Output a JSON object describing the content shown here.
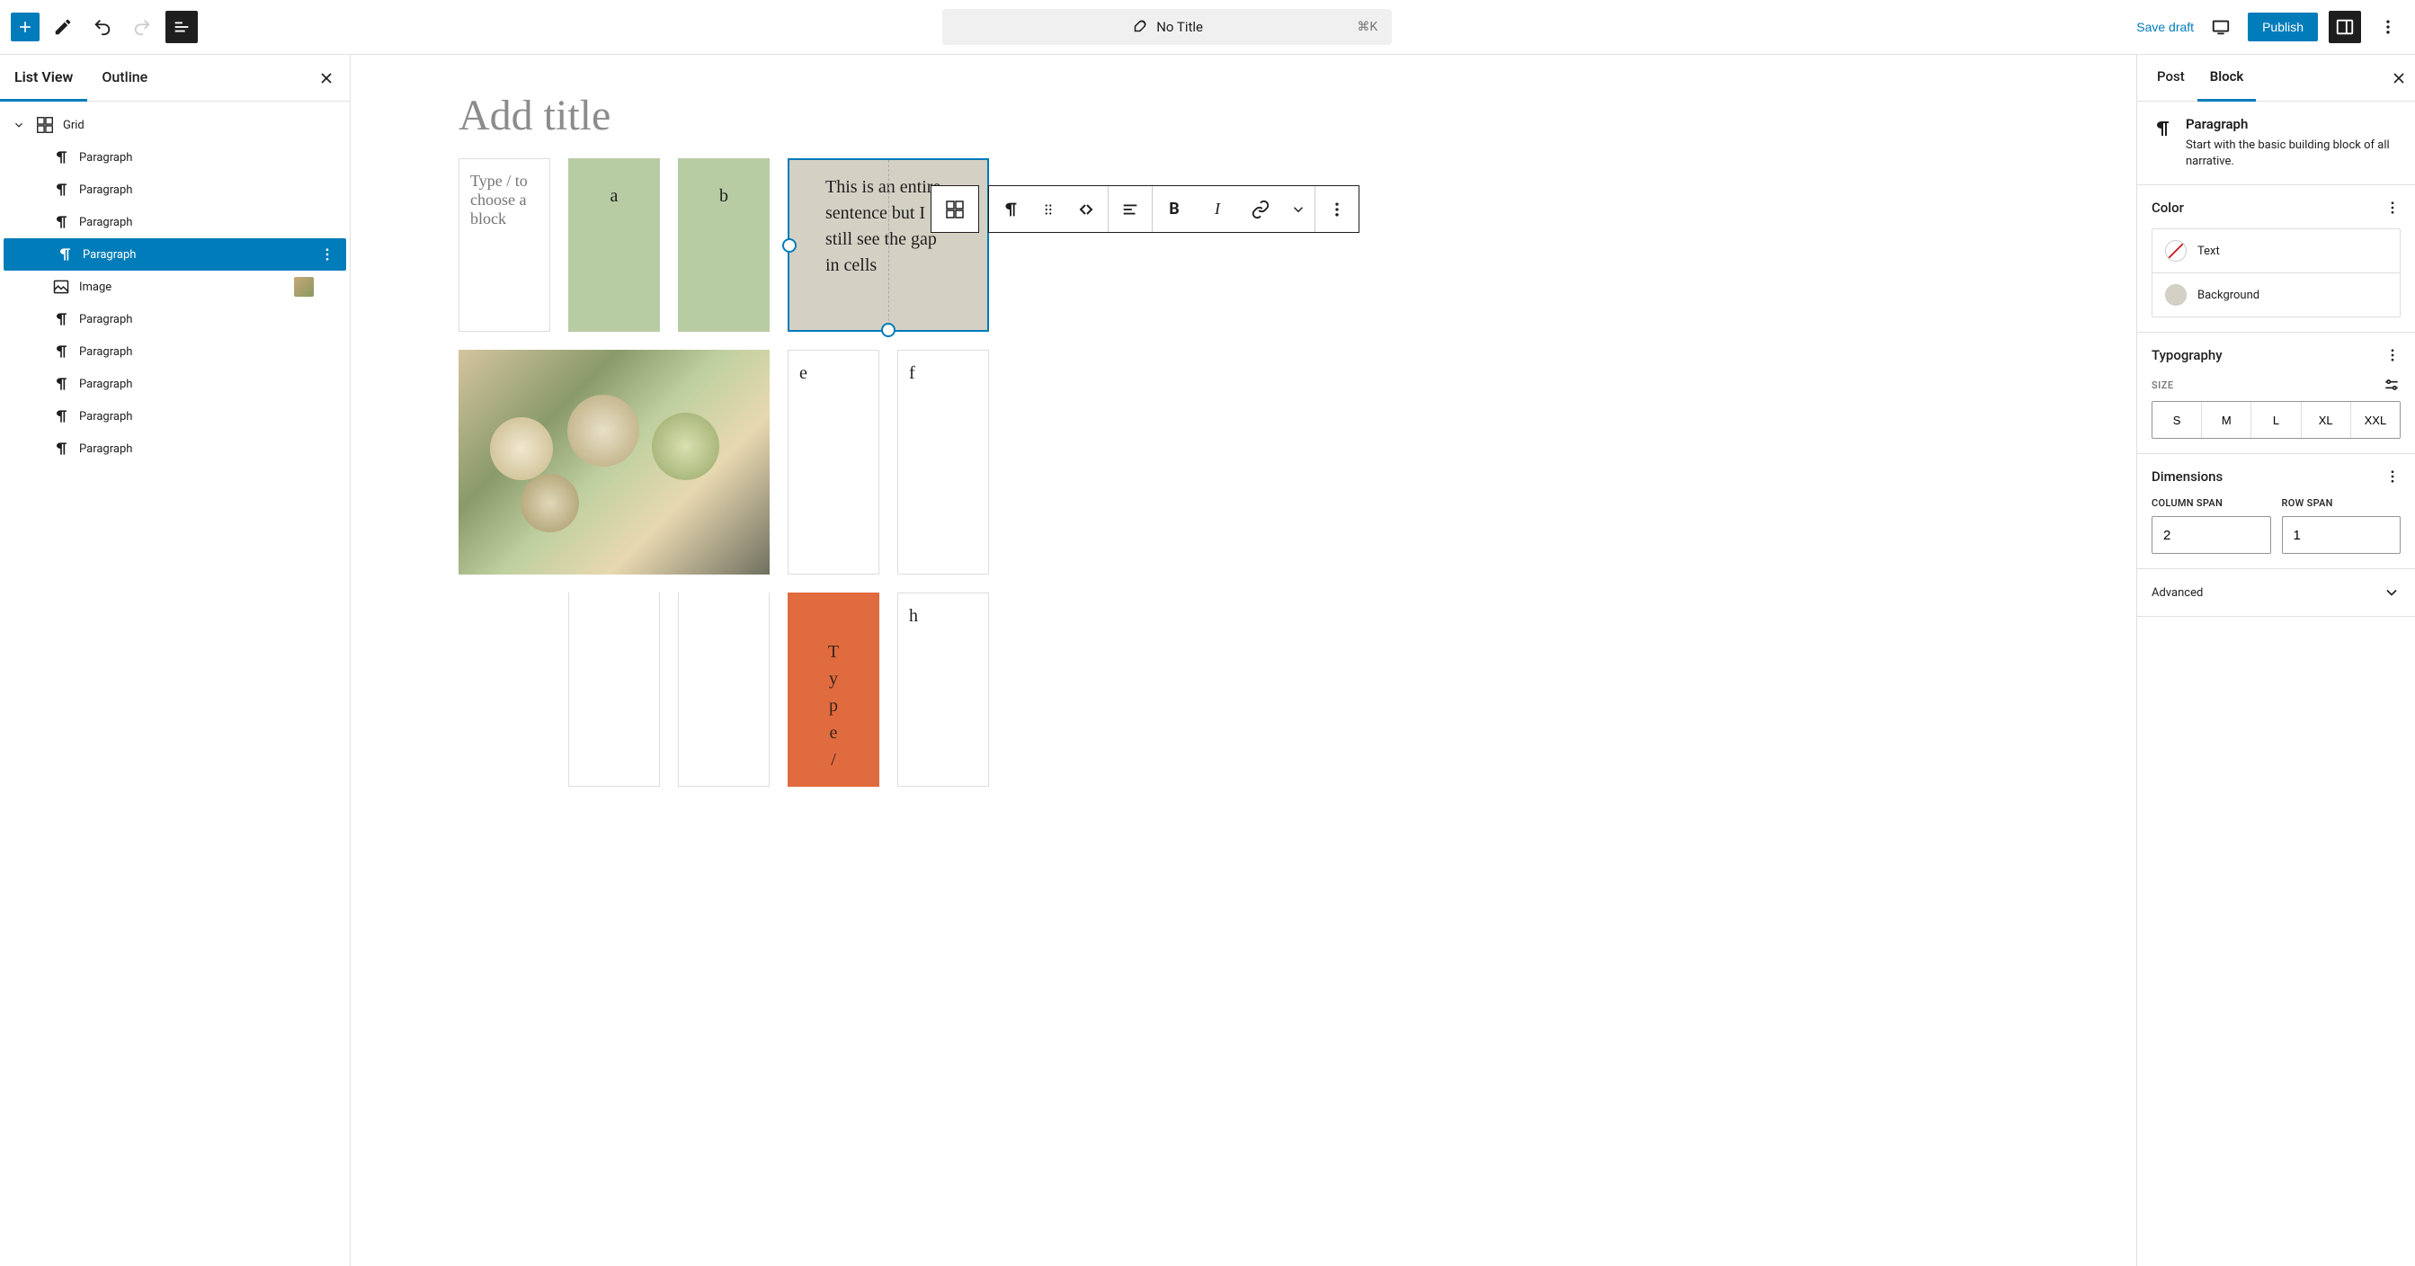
{
  "toolbar": {
    "title": "No Title",
    "shortcut": "⌘K",
    "save_draft": "Save draft",
    "publish": "Publish"
  },
  "left_panel": {
    "tabs": {
      "list_view": "List View",
      "outline": "Outline"
    },
    "tree": {
      "root": "Grid",
      "items": [
        {
          "type": "paragraph",
          "label": "Paragraph"
        },
        {
          "type": "paragraph",
          "label": "Paragraph"
        },
        {
          "type": "paragraph",
          "label": "Paragraph"
        },
        {
          "type": "paragraph",
          "label": "Paragraph",
          "selected": true
        },
        {
          "type": "image",
          "label": "Image"
        },
        {
          "type": "paragraph",
          "label": "Paragraph"
        },
        {
          "type": "paragraph",
          "label": "Paragraph"
        },
        {
          "type": "paragraph",
          "label": "Paragraph"
        },
        {
          "type": "paragraph",
          "label": "Paragraph"
        },
        {
          "type": "paragraph",
          "label": "Paragraph"
        }
      ]
    }
  },
  "canvas": {
    "title_placeholder": "Add title",
    "blocks": {
      "placeholder": "Type / to choose a block",
      "a": "a",
      "b": "b",
      "selected_text": "This is an entire sentence but I still see the gap in cells",
      "e": "e",
      "f": "f",
      "h": "h",
      "orange_text": "Type/"
    }
  },
  "right_panel": {
    "tabs": {
      "post": "Post",
      "block": "Block"
    },
    "block_name": "Paragraph",
    "block_desc": "Start with the basic building block of all narrative.",
    "panels": {
      "color": {
        "title": "Color",
        "text": "Text",
        "background": "Background"
      },
      "typography": {
        "title": "Typography",
        "size_label": "SIZE",
        "sizes": [
          "S",
          "M",
          "L",
          "XL",
          "XXL"
        ]
      },
      "dimensions": {
        "title": "Dimensions",
        "col_label": "COLUMN SPAN",
        "row_label": "ROW SPAN",
        "col_value": "2",
        "row_value": "1"
      },
      "advanced": "Advanced"
    }
  }
}
